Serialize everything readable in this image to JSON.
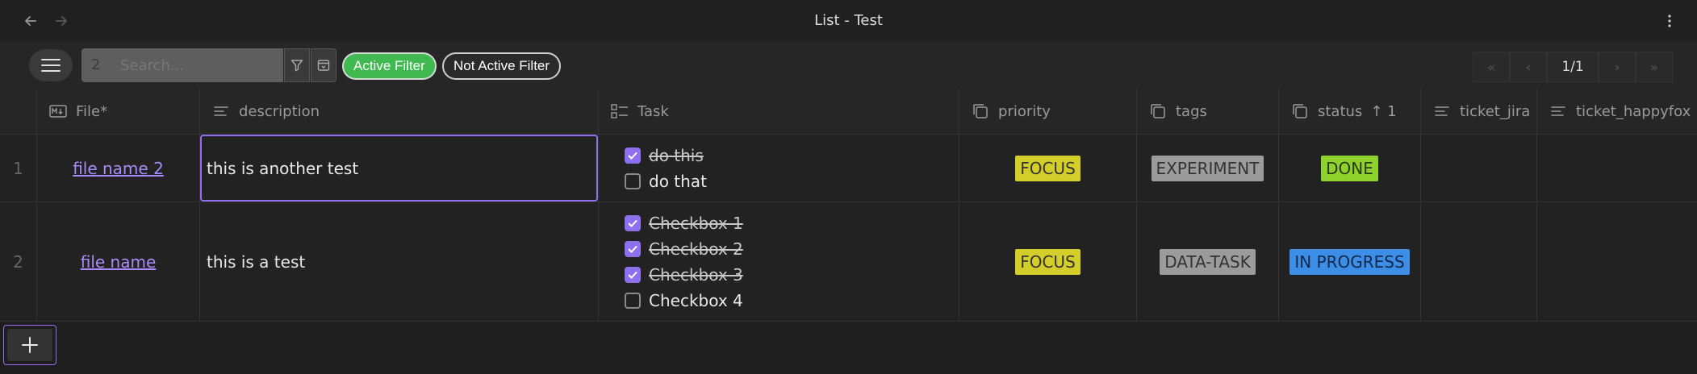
{
  "window": {
    "title": "List - Test"
  },
  "toolbar": {
    "search_count": "2",
    "search_placeholder": "Search...",
    "active_filter_label": "Active Filter",
    "inactive_filter_label": "Not Active Filter"
  },
  "pagination": {
    "label": "1/1"
  },
  "columns": [
    {
      "key": "file",
      "label": "File*",
      "icon": "markdown-icon"
    },
    {
      "key": "description",
      "label": "description",
      "icon": "text-lines-icon"
    },
    {
      "key": "task",
      "label": "Task",
      "icon": "checklist-icon"
    },
    {
      "key": "priority",
      "label": "priority",
      "icon": "copy-icon"
    },
    {
      "key": "tags",
      "label": "tags",
      "icon": "copy-icon"
    },
    {
      "key": "status",
      "label": "status",
      "icon": "copy-icon",
      "sort": "↑ 1"
    },
    {
      "key": "ticket_jira",
      "label": "ticket_jira",
      "icon": "text-lines-icon"
    },
    {
      "key": "ticket_happyfox",
      "label": "ticket_happyfox",
      "icon": "text-lines-icon"
    }
  ],
  "rows": [
    {
      "index": "1",
      "file": "file name 2",
      "description": "this is another test",
      "tasks": [
        {
          "label": "do this",
          "checked": true
        },
        {
          "label": "do that",
          "checked": false
        }
      ],
      "priority": "FOCUS",
      "tags": "EXPERIMENT",
      "status": "DONE",
      "ticket_jira": "",
      "ticket_happyfox": ""
    },
    {
      "index": "2",
      "file": "file name",
      "description": "this is a test",
      "tasks": [
        {
          "label": "Checkbox 1",
          "checked": true
        },
        {
          "label": "Checkbox 2",
          "checked": true
        },
        {
          "label": "Checkbox 3",
          "checked": true
        },
        {
          "label": "Checkbox 4",
          "checked": false
        }
      ],
      "priority": "FOCUS",
      "tags": "DATA-TASK",
      "status": "IN PROGRESS",
      "ticket_jira": "",
      "ticket_happyfox": ""
    }
  ],
  "colors": {
    "accent": "#8e6ff0",
    "focus": "#d4ce2a",
    "tag_grey": "#9b9b9b",
    "done": "#8fd12d",
    "in_progress": "#3d8ee6",
    "active_filter": "#3fb950"
  }
}
